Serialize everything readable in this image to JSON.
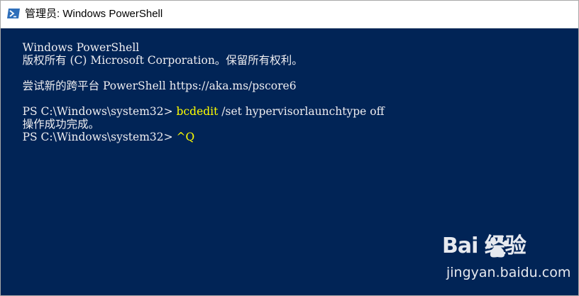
{
  "window": {
    "title": "管理员: Windows PowerShell",
    "icon": "powershell-icon"
  },
  "console": {
    "lines": [
      {
        "text": "Windows PowerShell"
      },
      {
        "text": "版权所有 (C) Microsoft Corporation。保留所有权利。"
      },
      {
        "text": ""
      },
      {
        "text": "尝试新的跨平台 PowerShell https://aka.ms/pscore6"
      },
      {
        "text": ""
      },
      {
        "prompt": "PS C:\\Windows\\system32> ",
        "command": "bcdedit",
        "args": " /set hypervisorlaunchtype off"
      },
      {
        "text": "操作成功完成。"
      },
      {
        "prompt": "PS C:\\Windows\\system32> ",
        "command": "^Q"
      }
    ]
  },
  "watermark": {
    "logo": "Bai 经验",
    "site": "jingyan.baidu.com"
  },
  "colors": {
    "console_bg": "#012456",
    "console_fg": "#eeedf0",
    "command_fg": "#ffff00",
    "titlebar_bg": "#ffffff"
  }
}
